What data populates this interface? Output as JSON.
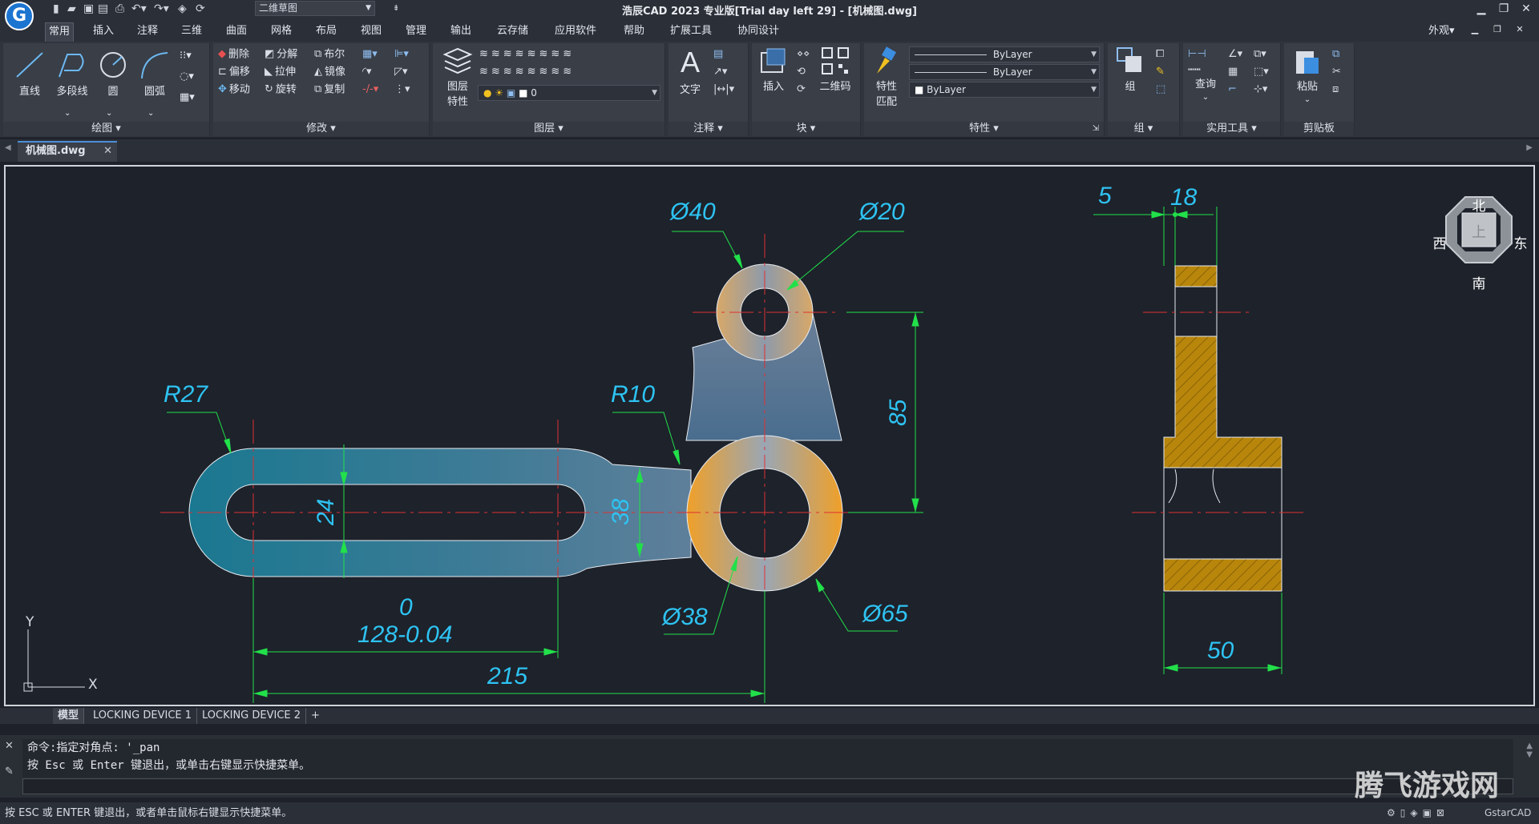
{
  "app": {
    "title": "浩辰CAD 2023 专业版[Trial day left 29] - [机械图.dwg]",
    "logo_letter": "G",
    "workspace": "二维草图",
    "workspace_mode": "外观▾"
  },
  "menu": [
    "常用",
    "插入",
    "注释",
    "三维",
    "曲面",
    "网格",
    "布局",
    "视图",
    "管理",
    "输出",
    "云存储",
    "应用软件",
    "帮助",
    "扩展工具",
    "协同设计"
  ],
  "ribbon": {
    "draw": {
      "title": "绘图",
      "line": "直线",
      "polyline": "多段线",
      "circle": "圆",
      "arc": "圆弧"
    },
    "modify": {
      "title": "修改",
      "erase": "删除",
      "explode": "分解",
      "boolean": "布尔",
      "offset": "偏移",
      "stretch": "拉伸",
      "mirror": "镜像",
      "move": "移动",
      "rotate": "旋转",
      "copy": "复制"
    },
    "layers": {
      "title": "图层",
      "props_1": "图层",
      "props_2": "特性",
      "current_layer": "0"
    },
    "annotation": {
      "title": "注释",
      "text": "文字"
    },
    "block": {
      "title": "块",
      "insert": "插入",
      "qrcode": "二维码"
    },
    "properties": {
      "title": "特性",
      "match_1": "特性",
      "match_2": "匹配",
      "color": "ByLayer",
      "linetype": "ByLayer",
      "lineweight": "ByLayer"
    },
    "group": {
      "title": "组",
      "group": "组"
    },
    "utilities": {
      "title": "实用工具",
      "query": "查询"
    },
    "clipboard": {
      "title": "剪贴板",
      "paste": "粘贴"
    }
  },
  "file_tab": "机械图.dwg",
  "drawing": {
    "dims": {
      "d40": "Ø40",
      "d20": "Ø20",
      "r27": "R27",
      "r10": "R10",
      "d24": "24",
      "d38": "38",
      "d85": "85",
      "tol_upper": "0",
      "tol_main": "128-0.04",
      "d215": "215",
      "d38_hole": "Ø38",
      "d65": "Ø65",
      "s5": "5",
      "s18": "18",
      "s50": "50"
    },
    "viewcube": {
      "north": "北",
      "south": "南",
      "east": "东",
      "west": "西",
      "top": "上"
    },
    "ucs": {
      "x": "X",
      "y": "Y"
    },
    "colors": {
      "dim": "#2ec3f2",
      "leader": "#22e04a",
      "center": "#e03030",
      "hatch": "#b8860b"
    }
  },
  "layout_tabs": [
    "模型",
    "LOCKING DEVICE 1",
    "LOCKING DEVICE 2",
    "+"
  ],
  "command": {
    "line1": "命令:指定对角点: '_pan",
    "line2": "按 Esc 或 Enter 键退出，或单击右键显示快捷菜单。"
  },
  "status": "按 ESC 或 ENTER 键退出，或者单击鼠标右键显示快捷菜单。",
  "watermark": {
    "text": "腾飞游戏网",
    "brand": "GstarCAD"
  }
}
